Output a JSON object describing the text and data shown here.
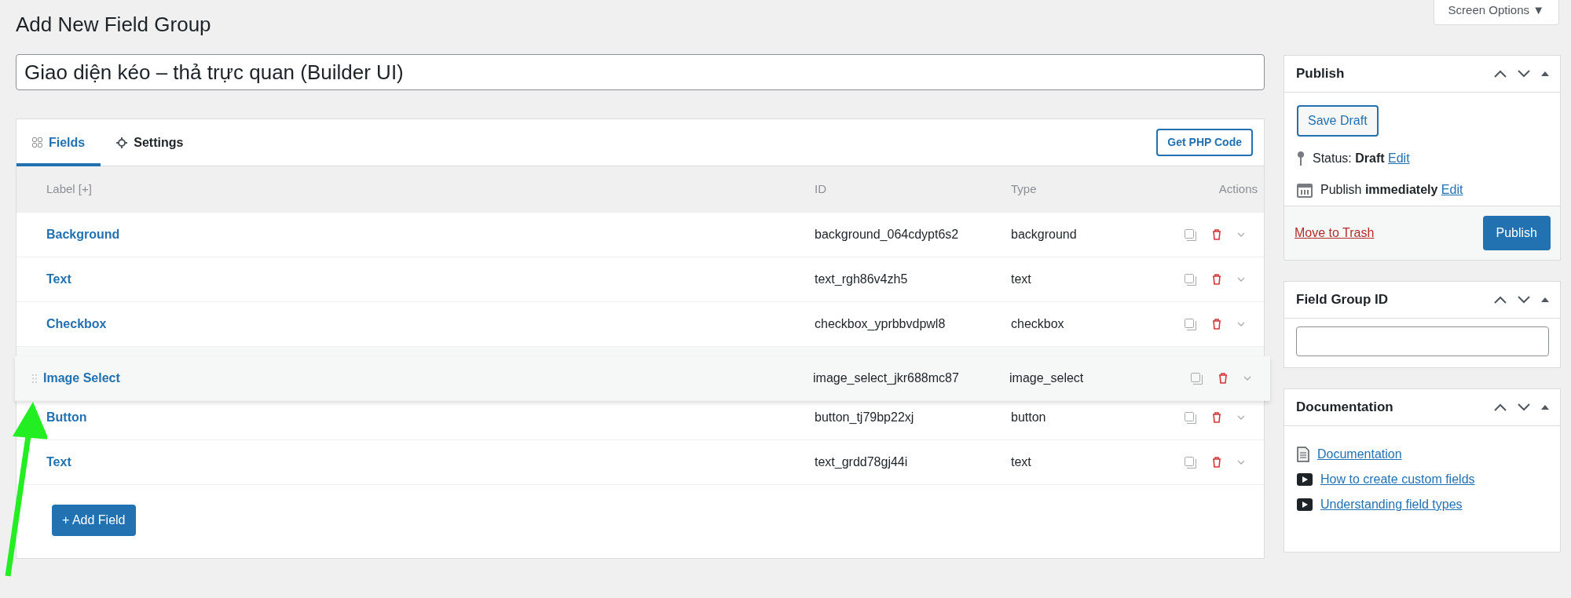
{
  "page_title": "Add New Field Group",
  "screen_options": {
    "label": "Screen Options",
    "caret": "▼"
  },
  "title_field": {
    "value": "Giao diện kéo – thả trực quan (Builder UI)"
  },
  "tabs": [
    {
      "label": "Fields",
      "selected": true
    },
    {
      "label": "Settings",
      "selected": false
    }
  ],
  "get_php_button": "Get PHP Code",
  "table": {
    "columns": [
      "Label [+]",
      "ID",
      "Type",
      "Actions"
    ],
    "rows": [
      {
        "label": "Background",
        "id": "background_064cdypt6s2",
        "type": "background",
        "dragging": false
      },
      {
        "label": "Text",
        "id": "text_rgh86v4zh5",
        "type": "text",
        "dragging": false
      },
      {
        "label": "Checkbox",
        "id": "checkbox_yprbbvdpwl8",
        "type": "checkbox",
        "dragging": false
      },
      {
        "label": "Image Select",
        "id": "image_select_jkr688mc87",
        "type": "image_select",
        "dragging": true
      },
      {
        "label": "Button",
        "id": "button_tj79bp22xj",
        "type": "button",
        "dragging": false
      },
      {
        "label": "Text",
        "id": "text_grdd78gj44i",
        "type": "text",
        "dragging": false
      }
    ]
  },
  "add_field_button": "+ Add Field",
  "sidebar": [
    {
      "kind": "publish",
      "title": "Publish",
      "save_draft": "Save Draft",
      "status_label": "Status:",
      "status_value": "Draft",
      "status_edit": "Edit",
      "publish_label": "Publish",
      "publish_value": "immediately",
      "publish_edit": "Edit",
      "trash": "Move to Trash",
      "publish_button": "Publish"
    },
    {
      "kind": "input",
      "title": "Field Group ID"
    },
    {
      "kind": "links",
      "title": "Documentation",
      "links": [
        {
          "label": "Documentation",
          "kind": "document"
        },
        {
          "label": "How to create custom fields",
          "kind": "video"
        },
        {
          "label": "Understanding field types",
          "kind": "video"
        }
      ]
    }
  ]
}
